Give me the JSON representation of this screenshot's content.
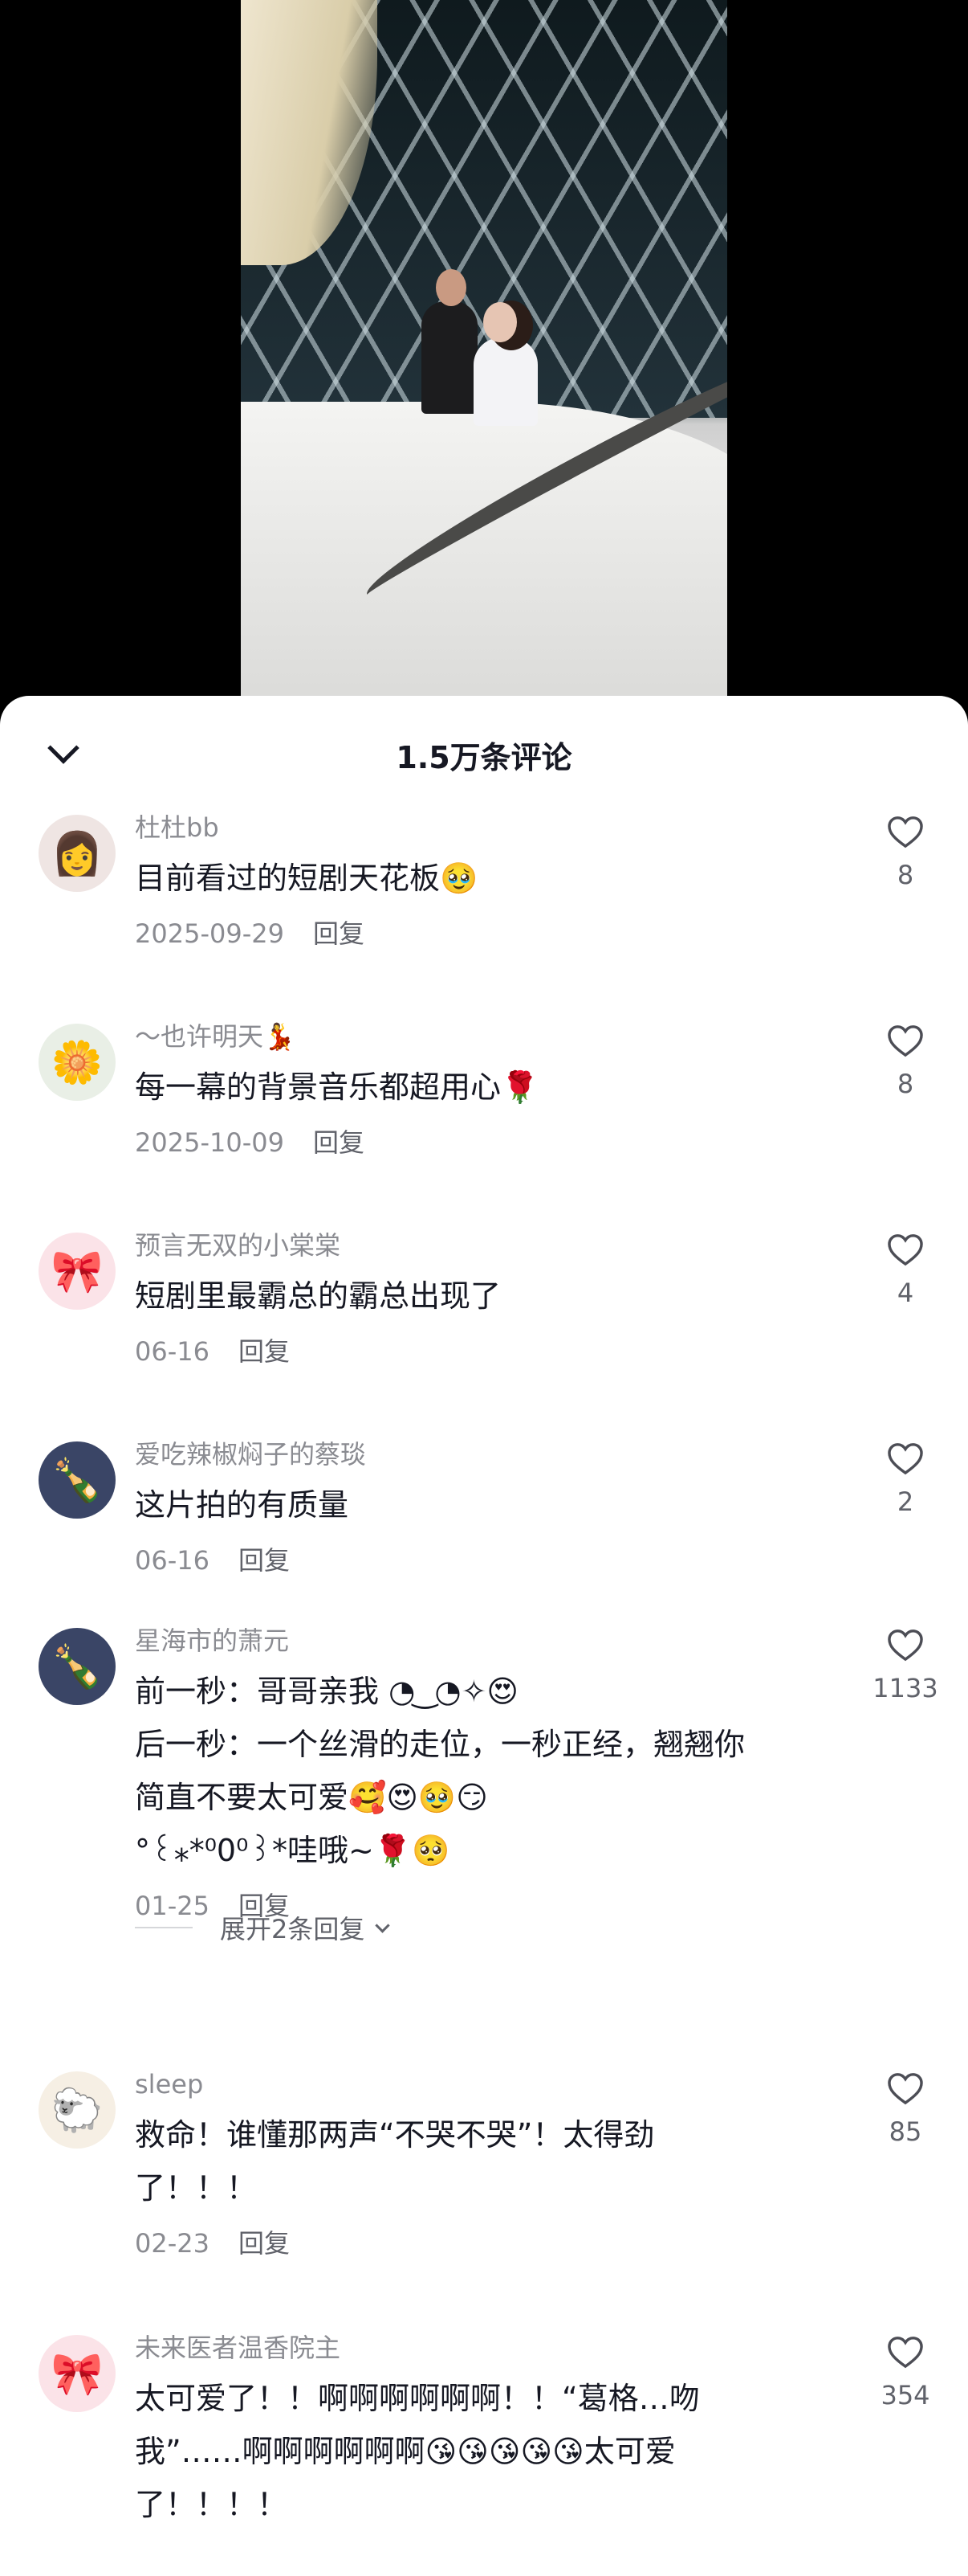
{
  "sheet": {
    "title": "1.5万条评论"
  },
  "comments": [
    {
      "user": "杜杜bb",
      "text": "目前看过的短剧天花板🥹",
      "date": "2025-09-29",
      "reply": "回复",
      "likes": "8",
      "avatar": "👩"
    },
    {
      "user": "～也许明天💃",
      "text": "每一幕的背景音乐都超用心🌹",
      "date": "2025-10-09",
      "reply": "回复",
      "likes": "8",
      "avatar": "🌼"
    },
    {
      "user": "预言无双的小棠棠",
      "text": "短剧里最霸总的霸总出现了",
      "date": "06-16",
      "reply": "回复",
      "likes": "4",
      "avatar": "🎀"
    },
    {
      "user": "爱吃辣椒焖子的蔡琰",
      "text": "这片拍的有质量",
      "date": "06-16",
      "reply": "回复",
      "likes": "2",
      "avatar": "🍾"
    },
    {
      "user": "星海市的萧元",
      "text_lines": [
        "前一秒：哥哥亲我 ◔ ͜ ◔✧😍",
        "后一秒：一个丝滑的走位，一秒正经，翘翘你",
        "简直不要太可爱🥰😍🥹😏",
        "°꒰⁎*⁰0⁰꒱*哇哦~🌹🥺"
      ],
      "date": "01-25",
      "reply": "回复",
      "likes": "1133",
      "avatar": "🍾",
      "expand": "展开2条回复"
    },
    {
      "user": "sleep",
      "text_lines": [
        "救命！谁懂那两声“不哭不哭”！太得劲",
        "了！！！"
      ],
      "date": "02-23",
      "reply": "回复",
      "likes": "85",
      "avatar": "🐑"
    },
    {
      "user": "未来医者温香院主",
      "text_lines": [
        "太可爱了！！啊啊啊啊啊啊！！“葛格…吻",
        "我”……啊啊啊啊啊啊😘😘😘😘😘太可爱",
        "了！！！！"
      ],
      "likes": "354",
      "avatar": "🎀"
    }
  ]
}
